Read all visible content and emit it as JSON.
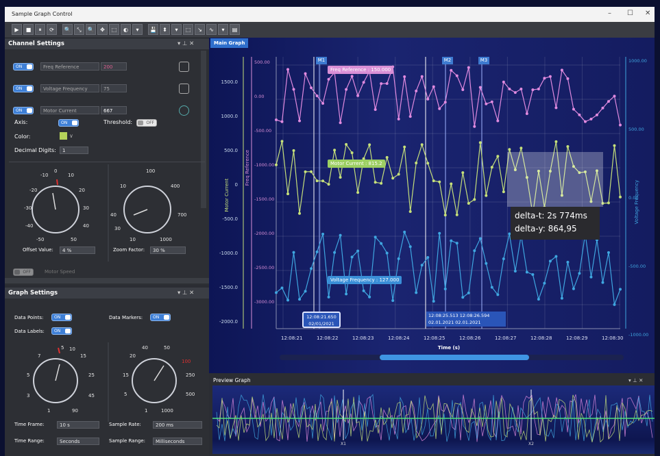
{
  "window": {
    "title": "Sample Graph Control",
    "controls": [
      "–",
      "☐",
      "✕"
    ]
  },
  "toolbar": {
    "buttons": [
      "▶",
      "■",
      "⏸",
      "⟳",
      "🔍",
      "⤡",
      "🔍",
      "✥",
      "⬚",
      "◐",
      "▾",
      "💾",
      "⬍",
      "▾",
      "⬚",
      "↘",
      "∿",
      "▾",
      "▤"
    ]
  },
  "channel_settings": {
    "title": "Channel Settings",
    "channels": [
      {
        "toggle": "ON",
        "name": "Freq Reference",
        "value": "200",
        "color": "#e06090"
      },
      {
        "toggle": "ON",
        "name": "Voltage Frequency",
        "value": "75",
        "color": "#9a9a9a"
      },
      {
        "toggle": "ON",
        "name": "Motor Current",
        "value": "667",
        "color": "#e0e0e0"
      }
    ],
    "axis_label": "Axis:",
    "axis_toggle": "ON",
    "threshold_label": "Threshold:",
    "threshold_toggle": "OFF",
    "color_label": "Color:",
    "color_value": "#b5d35a",
    "decimal_label": "Decimal Digits:",
    "decimal_value": "1",
    "offset_ticks": [
      "-10",
      "0",
      "10",
      "-20",
      "20",
      "-30",
      "30",
      "-40",
      "40",
      "-50",
      "50"
    ],
    "offset_label": "Offset Value:",
    "offset_value": "4 %",
    "zoom_ticks": [
      "100",
      "10",
      "400",
      "40",
      "700",
      "30",
      "10",
      "1000"
    ],
    "zoom_label": "Zoom Factor:",
    "zoom_value": "30 %",
    "hidden_channel": {
      "toggle": "OFF",
      "name": "Motor Speed"
    }
  },
  "graph_settings": {
    "title": "Graph Settings",
    "data_points_label": "Data Points:",
    "data_points_toggle": "ON",
    "data_labels_label": "Data Labels:",
    "data_labels_toggle": "ON",
    "data_markers_label": "Data Markers:",
    "data_markers_toggle": "ON",
    "time_frame_ticks": [
      "5",
      "10",
      "7",
      "15",
      "5",
      "25",
      "3",
      "45",
      "1",
      "90"
    ],
    "time_frame_label": "Time Frame:",
    "time_frame_value": "10 s",
    "time_range_label": "Time Range:",
    "time_range_value": "Seconds",
    "sample_rate_ticks": [
      "40",
      "50",
      "20",
      "100",
      "15",
      "250",
      "5",
      "500",
      "1",
      "1000"
    ],
    "sample_rate_label": "Sample Rate:",
    "sample_rate_value": "200 ms",
    "sample_range_label": "Sample Range:",
    "sample_range_value": "Milliseconds"
  },
  "main_graph": {
    "tab": "Main Graph",
    "markers": [
      "M1",
      "M2",
      "M3"
    ],
    "left_axis_label": "Motor Current",
    "left_ticks": [
      "1500.0",
      "1000.0",
      "500.0",
      "0",
      "-500.0",
      "-1000.0",
      "-1500.0",
      "-2000.0"
    ],
    "freq_axis_label": "Freq Reference",
    "freq_ticks": [
      "500.00",
      "0.00",
      "-500.00",
      "-1000.00",
      "-1500.00",
      "-2000.00",
      "-2500.00",
      "-3000.00"
    ],
    "right_axis_label": "Voltage Frequency",
    "right_ticks": [
      "1000.00",
      "500.00",
      "0.00",
      "-500.00",
      "-1000.00"
    ],
    "x_label": "Time (s)",
    "x_ticks": [
      "12:08:21",
      "12:08:22",
      "12:08:23",
      "12:08:24",
      "12:08:25",
      "12:08:26",
      "12:08:27",
      "12:08:28",
      "12:08:29",
      "12:08:30"
    ],
    "label_freq": "Freq Reference : 150.000",
    "label_motor": "Motor Current : 815.2",
    "label_voltage": "Voltage Frequency : 127.000",
    "cursor1": [
      "12:08:21.650",
      "02/01/2021"
    ],
    "cursor2": [
      "12:08:25.513  12:08:26.594",
      "02.01.2021   02.01.2021"
    ],
    "delta_t": "delta-t: 2s 774ms",
    "delta_y": "delta-y: 864,95",
    "colors": {
      "freq": "#e08adf",
      "motor": "#c6e07a",
      "voltage": "#3fa6e0",
      "grid": "#ffffff"
    }
  },
  "preview_graph": {
    "title": "Preview Graph",
    "marker1": "X1",
    "marker2": "X2"
  }
}
